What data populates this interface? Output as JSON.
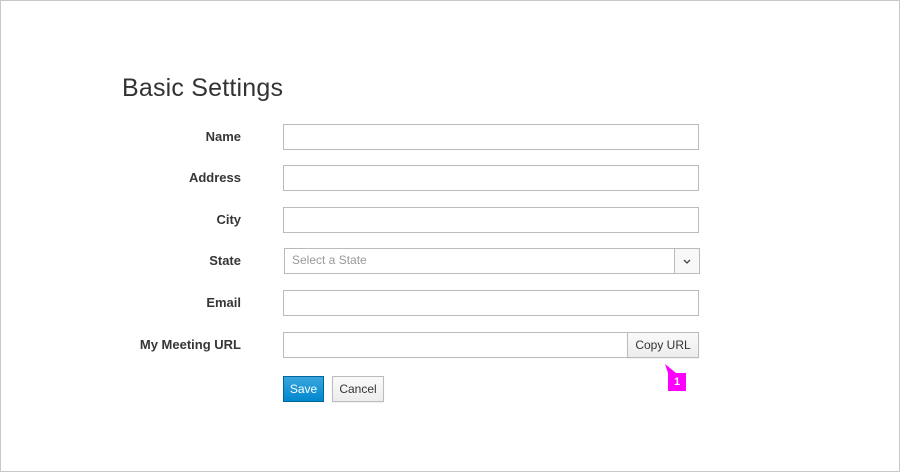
{
  "page": {
    "title": "Basic Settings"
  },
  "form": {
    "fields": [
      {
        "label": "Name",
        "value": "",
        "placeholder": ""
      },
      {
        "label": "Address",
        "value": "",
        "placeholder": ""
      },
      {
        "label": "City",
        "value": "",
        "placeholder": ""
      },
      {
        "label": "State",
        "selected": "Select a State"
      },
      {
        "label": "Email",
        "value": "",
        "placeholder": ""
      },
      {
        "label": "My Meeting URL",
        "value": "",
        "copy_button_label": "Copy URL"
      }
    ],
    "actions": {
      "save_label": "Save",
      "cancel_label": "Cancel"
    }
  },
  "annotation": {
    "marker_number": "1",
    "marker_color": "#ff00ff"
  },
  "colors": {
    "primary_button": "#0088ce",
    "border": "#bbbbbb",
    "text": "#363636"
  },
  "icons": {
    "state_select_arrow": "chevron-down-icon"
  }
}
